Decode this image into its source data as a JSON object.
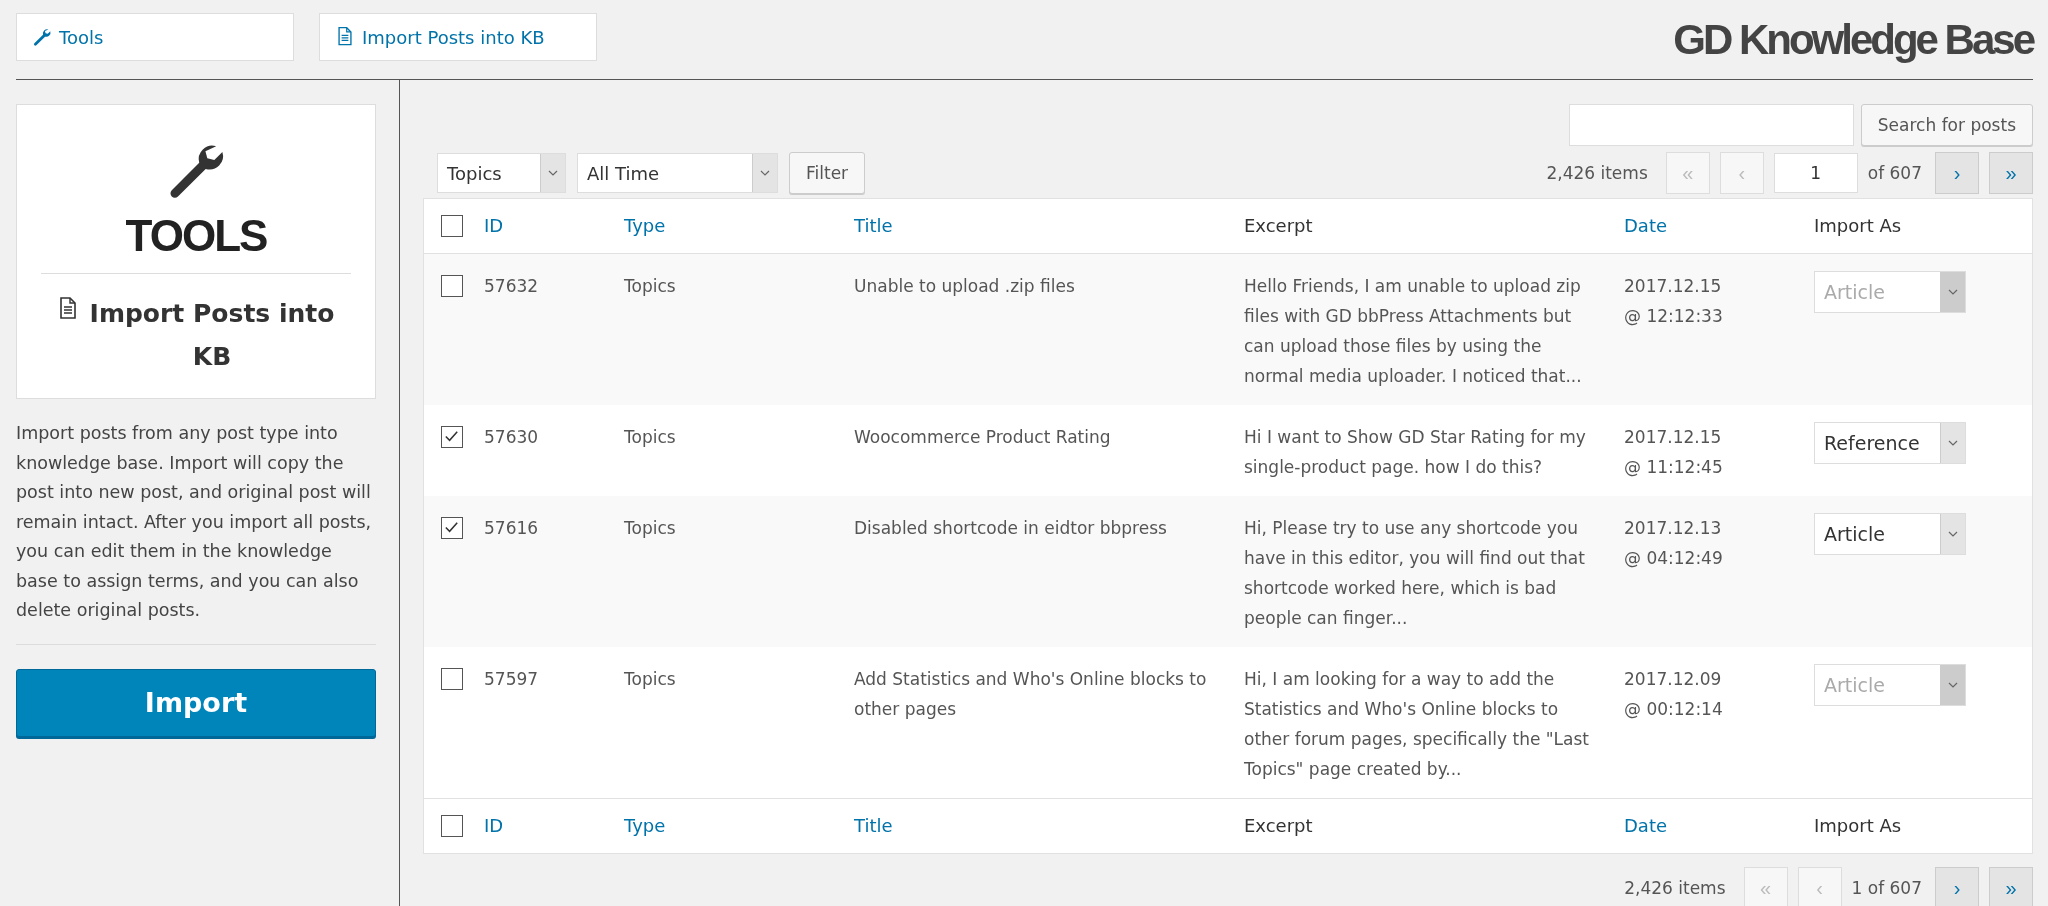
{
  "nav_tabs": [
    {
      "label": "Tools",
      "kind": "wrench"
    },
    {
      "label": "Import Posts into KB",
      "kind": "document"
    }
  ],
  "logo": "GD Knowledge Base",
  "sidebar": {
    "card_title": "TOOLS",
    "card_subtitle": "Import Posts into KB",
    "description": "Import posts from any post type into knowledge base. Import will copy the post into new post, and original post will remain intact. After you import all posts, you can edit them in the knowledge base to assign terms, and you can also delete original posts.",
    "import_button": "Import"
  },
  "search": {
    "button": "Search for posts"
  },
  "filters": {
    "post_type": "Topics",
    "period": "All Time",
    "button": "Filter"
  },
  "top_pagination": {
    "items": "2,426 items",
    "page": "1",
    "of": "of 607",
    "buttons": [
      {
        "label": "«",
        "disabled": true
      },
      {
        "label": "‹",
        "disabled": true
      },
      {
        "label": "›",
        "disabled": false
      },
      {
        "label": "»",
        "disabled": false
      }
    ]
  },
  "table": {
    "header_checked": false,
    "footer_checked": false,
    "columns": [
      {
        "label": "ID",
        "sortable": true
      },
      {
        "label": "Type",
        "sortable": true
      },
      {
        "label": "Title",
        "sortable": true
      },
      {
        "label": "Excerpt",
        "sortable": false
      },
      {
        "label": "Date",
        "sortable": true
      },
      {
        "label": "Import As",
        "sortable": false
      }
    ],
    "rows": [
      {
        "checked": false,
        "id": "57632",
        "type": "Topics",
        "title": "Unable to upload .zip files",
        "excerpt": "Hello Friends, I am unable to upload zip files with GD bbPress Attachments but can upload those files by using the normal media uploader. I noticed that...",
        "date": "2017.12.15",
        "time": "@ 12:12:33",
        "import_as": "Article",
        "disabled": true
      },
      {
        "checked": true,
        "id": "57630",
        "type": "Topics",
        "title": "Woocommerce Product Rating",
        "excerpt": "Hi I want to Show GD Star Rating for my single-product page. how I do this?",
        "date": "2017.12.15",
        "time": "@ 11:12:45",
        "import_as": "Reference",
        "disabled": false
      },
      {
        "checked": true,
        "id": "57616",
        "type": "Topics",
        "title": "Disabled shortcode in eidtor bbpress",
        "excerpt": "Hi, Please try to use any shortcode you have in this editor, you will find out that shortcode worked here, which is bad people can finger...",
        "date": "2017.12.13",
        "time": "@ 04:12:49",
        "import_as": "Article",
        "disabled": false
      },
      {
        "checked": false,
        "id": "57597",
        "type": "Topics",
        "title": "Add Statistics and Who's Online blocks to other pages",
        "excerpt": "Hi, I am looking for a way to add the Statistics and Who's Online blocks to other forum pages, specifically the \"Last Topics\" page created by...",
        "date": "2017.12.09",
        "time": "@ 00:12:14",
        "import_as": "Article",
        "disabled": true
      }
    ],
    "footer_columns": [
      {
        "label": "ID",
        "sortable": true
      },
      {
        "label": "Type",
        "sortable": true
      },
      {
        "label": "Title",
        "sortable": true
      },
      {
        "label": "Excerpt",
        "sortable": false
      },
      {
        "label": "Date",
        "sortable": true
      },
      {
        "label": "Import As",
        "sortable": false
      }
    ]
  },
  "bottom_pagination": {
    "items": "2,426 items",
    "page_info": "1 of 607",
    "buttons": [
      {
        "label": "«",
        "disabled": true
      },
      {
        "label": "‹",
        "disabled": true
      },
      {
        "label": "›",
        "disabled": false
      },
      {
        "label": "»",
        "disabled": false
      }
    ]
  }
}
